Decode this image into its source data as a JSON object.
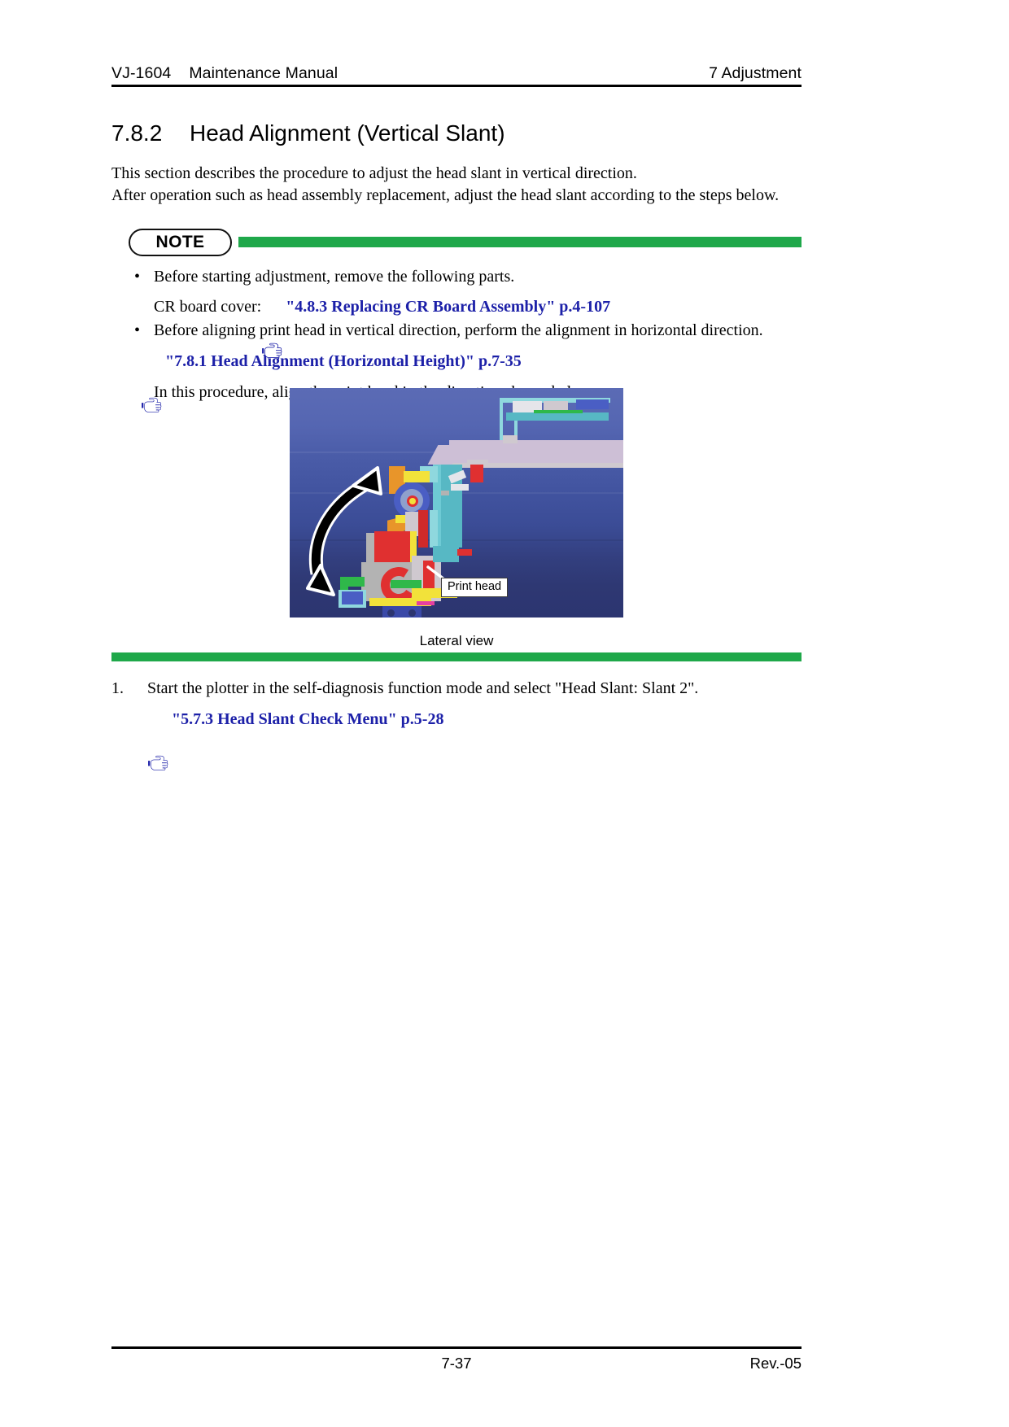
{
  "header": {
    "model": "VJ-1604",
    "manual": "Maintenance Manual",
    "chapter": "7 Adjustment"
  },
  "section": {
    "number": "7.8.2",
    "title": "Head Alignment (Vertical Slant)"
  },
  "intro": {
    "line1": "This section describes the procedure to adjust the head slant in vertical direction.",
    "line2": "After operation such as head assembly replacement, adjust the head slant according to the steps below."
  },
  "note": {
    "label": "NOTE",
    "bar_color": "#1fa84a",
    "bullet_marker": "•",
    "hand_icon": "pointing-hand-icon",
    "items": [
      {
        "bullet": "Before starting adjustment, remove the following parts.",
        "sub_prefix": "CR board cover:",
        "sub_xref": "\"4.8.3 Replacing CR Board Assembly\" p.4-107"
      },
      {
        "bullet": "Before aligning print head in vertical direction, perform the alignment in horizontal direction.",
        "sub_xref": "\"7.8.1 Head Alignment (Horizontal Height)\" p.7-35",
        "sub_plain": "In this procedure, align the print head in the direction shown below."
      }
    ],
    "figure": {
      "callout": "Print head",
      "caption": "Lateral view",
      "alt": "lateral-view-of-print-head-carriage-assembly"
    }
  },
  "steps": [
    {
      "number": "1.",
      "text": "Start the plotter in the self-diagnosis function mode and select \"Head Slant: Slant 2\".",
      "xref": "\"5.7.3 Head Slant Check Menu\" p.5-28"
    }
  ],
  "footer": {
    "page": "7-37",
    "revision": "Rev.-05"
  },
  "colors": {
    "link": "#1c20a8",
    "accent_green": "#1fa84a",
    "text": "#000000"
  }
}
